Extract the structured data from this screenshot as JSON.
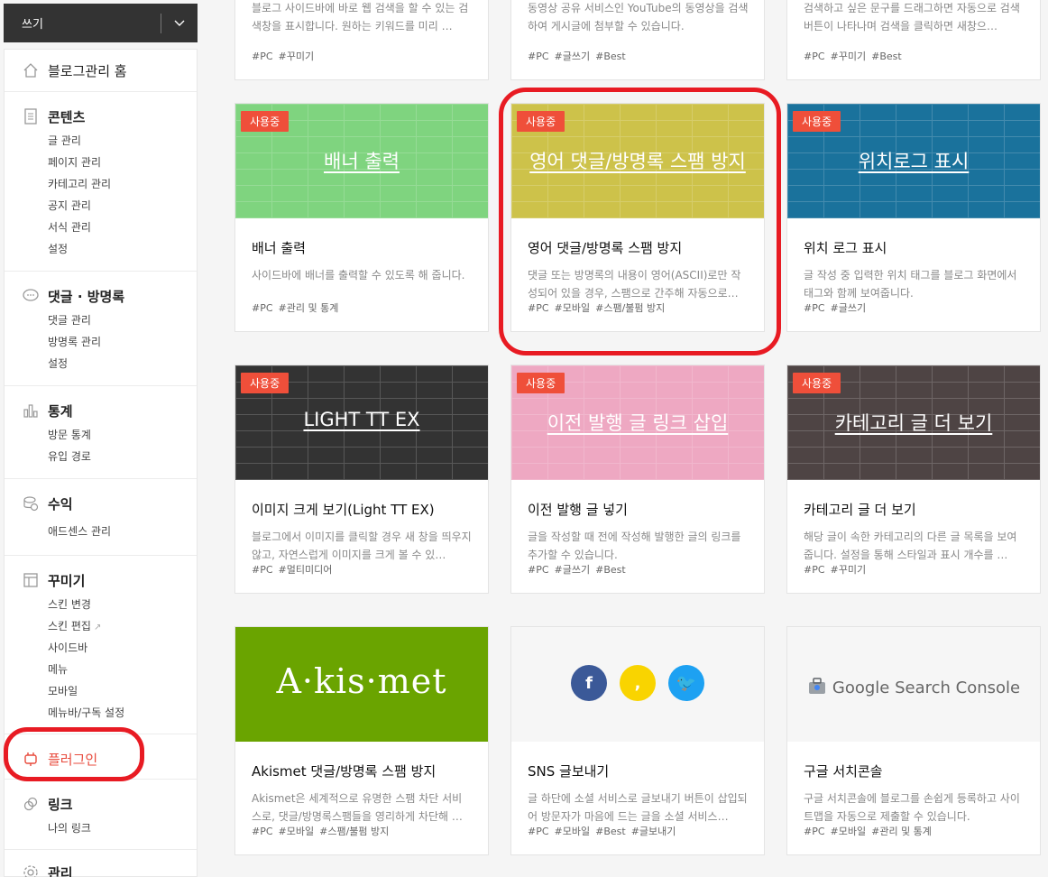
{
  "sidebar": {
    "write_label": "쓰기",
    "home": "블로그관리 홈",
    "contents": {
      "title": "콘텐츠",
      "items": [
        "글 관리",
        "페이지 관리",
        "카테고리 관리",
        "공지 관리",
        "서식 관리",
        "설정"
      ]
    },
    "comments": {
      "title": "댓글 · 방명록",
      "items": [
        "댓글 관리",
        "방명록 관리",
        "설정"
      ]
    },
    "stats": {
      "title": "통계",
      "items": [
        "방문 통계",
        "유입 경로"
      ]
    },
    "revenue": {
      "title": "수익",
      "items": [
        "애드센스 관리"
      ]
    },
    "decorate": {
      "title": "꾸미기",
      "items": [
        "스킨 변경",
        "스킨 편집",
        "사이드바",
        "메뉴",
        "모바일",
        "메뉴바/구독 설정"
      ]
    },
    "plugin": {
      "title": "플러그인"
    },
    "link": {
      "title": "링크",
      "items": [
        "나의 링크"
      ]
    },
    "manage": {
      "title": "관리"
    }
  },
  "top_cards": [
    {
      "desc": "블로그 사이드바에 바로 웹 검색을 할 수 있는 검색창을 표시합니다. 원하는 키워드를 미리 …",
      "tags": [
        "#PC",
        "#꾸미기"
      ]
    },
    {
      "desc": "동영상 공유 서비스인 YouTube의 동영상을 검색하여 게시글에 첨부할 수 있습니다.",
      "tags": [
        "#PC",
        "#글쓰기",
        "#Best"
      ]
    },
    {
      "desc": "검색하고 싶은 문구를 드래그하면 자동으로 검색 버튼이 나타나며 검색을 클릭하면 새창으…",
      "tags": [
        "#PC",
        "#꾸미기",
        "#Best"
      ]
    }
  ],
  "in_use_badge": "사용중",
  "cards": [
    {
      "banner_title": "배너 출력",
      "color": "#7fd47f",
      "name": "배너 출력",
      "desc": "사이드바에 배너를 출력할 수 있도록 해 줍니다.",
      "tags": [
        "#PC",
        "#관리 및 통계"
      ]
    },
    {
      "banner_title": "영어 댓글/방명록 스팸 방지",
      "color": "#cdc24a",
      "name": "영어 댓글/방명록 스팸 방지",
      "desc": "댓글 또는 방명록의 내용이 영어(ASCII)로만 작성되어 있을 경우, 스팸으로 간주해 자동으로…",
      "tags": [
        "#PC",
        "#모바일",
        "#스팸/불펌 방지"
      ]
    },
    {
      "banner_title": "위치로그 표시",
      "color": "#1a729c",
      "name": "위치 로그 표시",
      "desc": "글 작성 중 입력한 위치 태그를 블로그 화면에서 태그와 함께 보여줍니다.",
      "tags": [
        "#PC",
        "#글쓰기"
      ]
    },
    {
      "banner_title": "LIGHT TT EX",
      "color": "#333333",
      "name": "이미지 크게 보기(Light TT EX)",
      "desc": "블로그에서 이미지를 클릭할 경우 새 창을 띄우지 않고, 자연스럽게 이미지를 크게 볼 수 있…",
      "tags": [
        "#PC",
        "#멀티미디어"
      ]
    },
    {
      "banner_title": "이전 발행 글 링크 삽입",
      "color": "#eea8c2",
      "name": "이전 발행 글 넣기",
      "desc": "글을 작성할 때 전에 작성해 발행한 글의 링크를 추가할 수 있습니다.",
      "tags": [
        "#PC",
        "#글쓰기",
        "#Best"
      ]
    },
    {
      "banner_title": "카테고리 글 더 보기",
      "color": "#4e4444",
      "name": "카테고리 글 더 보기",
      "desc": "해당 글이 속한 카테고리의 다른 글 목록을 보여줍니다. 설정을 통해 스타일과 표시 개수를 …",
      "tags": [
        "#PC",
        "#꾸미기"
      ]
    },
    {
      "banner_title": "A·kis·met",
      "color": "#6aa400",
      "name": "Akismet 댓글/방명록 스팸 방지",
      "desc": "Akismet은 세계적으로 유명한 스팸 차단 서비스로, 댓글/방명록스팸들을 영리하게 차단해 …",
      "tags": [
        "#PC",
        "#모바일",
        "#스팸/불펌 방지"
      ]
    },
    {
      "banner_title": "",
      "color": "#f6f6f6",
      "name": "SNS 글보내기",
      "desc": "글 하단에 소셜 서비스로 글보내기 버튼이 삽입되어 방문자가 마음에 드는 글을 소셜 서비스…",
      "tags": [
        "#PC",
        "#모바일",
        "#Best",
        "#글보내기"
      ]
    },
    {
      "banner_title": "Google Search Console",
      "color": "#f6f6f6",
      "name": "구글 서치콘솔",
      "desc": "구글 서치콘솔에 블로그를 손쉽게 등록하고 사이트맵을 자동으로 제출할 수 있습니다.",
      "tags": [
        "#PC",
        "#모바일",
        "#관리 및 통계"
      ]
    }
  ]
}
